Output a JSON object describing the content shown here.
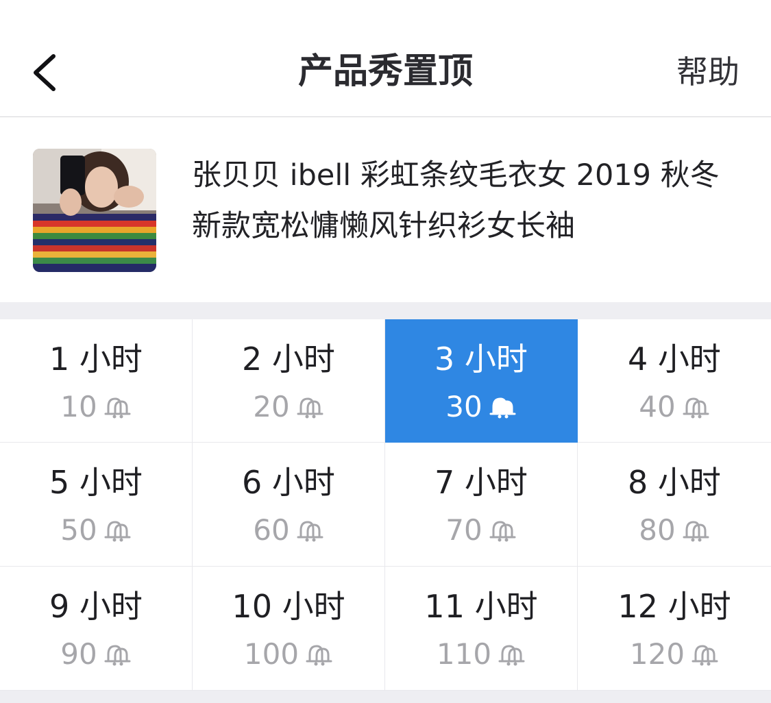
{
  "navbar": {
    "title": "产品秀置顶",
    "help_label": "帮助",
    "back_icon": "chevron-left-icon"
  },
  "product": {
    "title": "张贝贝 ibell 彩虹条纹毛衣女 2019 秋冬新款宽松慵懒风针织衫女长袖",
    "thumbnail": "product-photo"
  },
  "options": [
    {
      "hours": "1 小时",
      "price": "10",
      "selected": false
    },
    {
      "hours": "2 小时",
      "price": "20",
      "selected": false
    },
    {
      "hours": "3 小时",
      "price": "30",
      "selected": true
    },
    {
      "hours": "4 小时",
      "price": "40",
      "selected": false
    },
    {
      "hours": "5 小时",
      "price": "50",
      "selected": false
    },
    {
      "hours": "6 小时",
      "price": "60",
      "selected": false
    },
    {
      "hours": "7 小时",
      "price": "70",
      "selected": false
    },
    {
      "hours": "8 小时",
      "price": "80",
      "selected": false
    },
    {
      "hours": "9 小时",
      "price": "90",
      "selected": false
    },
    {
      "hours": "10 小时",
      "price": "100",
      "selected": false
    },
    {
      "hours": "11 小时",
      "price": "110",
      "selected": false
    },
    {
      "hours": "12 小时",
      "price": "120",
      "selected": false
    }
  ],
  "colors": {
    "accent": "#2f87e3",
    "muted_text": "#a6a6aa",
    "divider": "#e8e8ec",
    "band": "#eeeef2"
  },
  "price_icon": "bell-icon"
}
